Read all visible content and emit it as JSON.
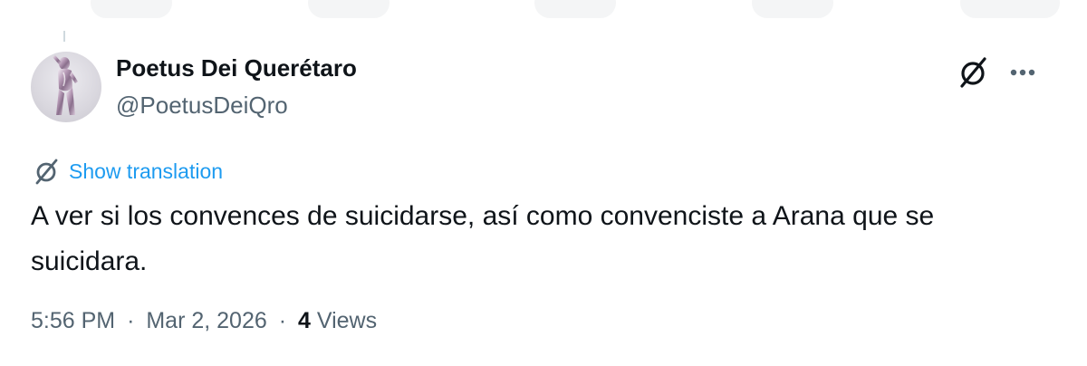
{
  "colors": {
    "text_primary": "#0f1419",
    "text_secondary": "#536471",
    "link": "#1d9bf0",
    "background": "#ffffff"
  },
  "author": {
    "display_name": "Poetus Dei Querétaro",
    "handle": "@PoetusDeiQro",
    "avatar_icon": "metallic-statue-avatar"
  },
  "actions": {
    "grok_icon": "grok-icon",
    "more_icon": "more-horizontal-icon"
  },
  "translation": {
    "icon": "grok-icon",
    "label": "Show translation"
  },
  "tweet": {
    "text": "A ver si los convences de suicidarse, así como convenciste a Arana que se suicidara."
  },
  "meta": {
    "time": "5:56 PM",
    "separator": "·",
    "date": "Mar 2, 2026",
    "views_count": "4",
    "views_label": "Views"
  }
}
